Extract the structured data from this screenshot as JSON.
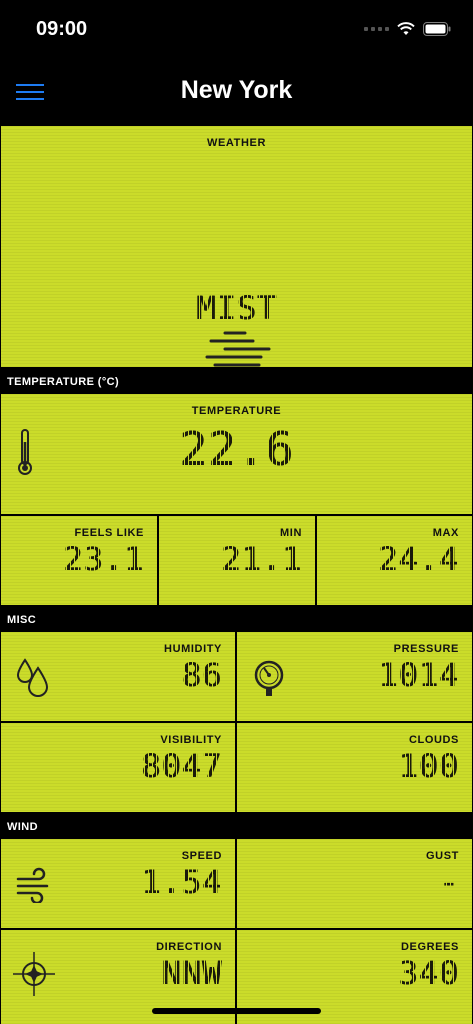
{
  "status_bar": {
    "time": "09:00"
  },
  "nav": {
    "title": "New York"
  },
  "weather": {
    "label": "WEATHER",
    "condition": "MIST"
  },
  "sections": {
    "temperature": "TEMPERATURE (°C)",
    "misc": "MISC",
    "wind": "WIND"
  },
  "temperature": {
    "main_label": "TEMPERATURE",
    "main_value": "22.6",
    "feels_like_label": "FEELS LIKE",
    "feels_like_value": "23.1",
    "min_label": "MIN",
    "min_value": "21.1",
    "max_label": "MAX",
    "max_value": "24.4"
  },
  "misc": {
    "humidity_label": "HUMIDITY",
    "humidity_value": "86",
    "pressure_label": "PRESSURE",
    "pressure_value": "1014",
    "visibility_label": "VISIBILITY",
    "visibility_value": "8047",
    "clouds_label": "CLOUDS",
    "clouds_value": "100"
  },
  "wind": {
    "speed_label": "SPEED",
    "speed_value": "1.54",
    "gust_label": "GUST",
    "gust_value": "-",
    "direction_label": "DIRECTION",
    "direction_value": "NNW",
    "degrees_label": "DEGREES",
    "degrees_value": "340"
  },
  "colors": {
    "lcd": "#cbdc2a",
    "accent": "#1e7cf2",
    "background": "#000000"
  }
}
